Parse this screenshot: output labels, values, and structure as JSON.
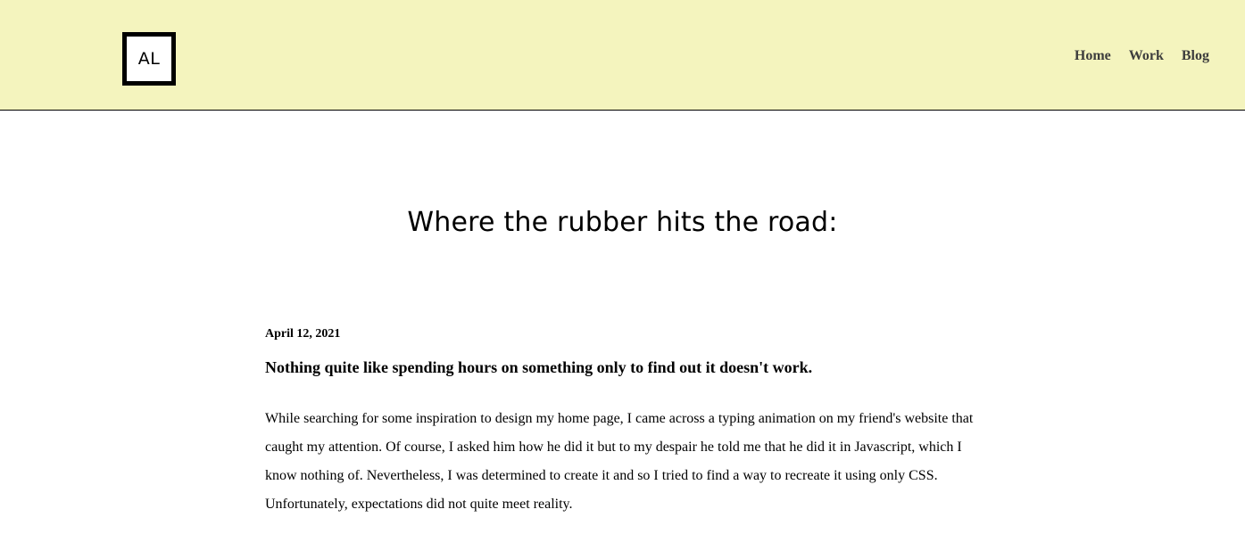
{
  "header": {
    "logo_text": "AL",
    "nav": [
      {
        "label": "Home"
      },
      {
        "label": "Work"
      },
      {
        "label": "Blog"
      }
    ]
  },
  "main": {
    "title": "Where the rubber hits the road:",
    "post": {
      "date": "April 12, 2021",
      "title": "Nothing quite like spending hours on something only to find out it doesn't work.",
      "body": "While searching for some inspiration to design my home page, I came across a typing animation on my friend's website that caught my attention. Of course, I asked him how he did it but to my despair he told me that he did it in Javascript, which I know nothing of. Nevertheless, I was determined to create it and so I tried to find a way to recreate it using only CSS. Unfortunately, expectations did not quite meet reality."
    }
  },
  "colors": {
    "header_background": "#f4f4be",
    "nav_text": "#3d3d3d",
    "text": "#000000"
  }
}
